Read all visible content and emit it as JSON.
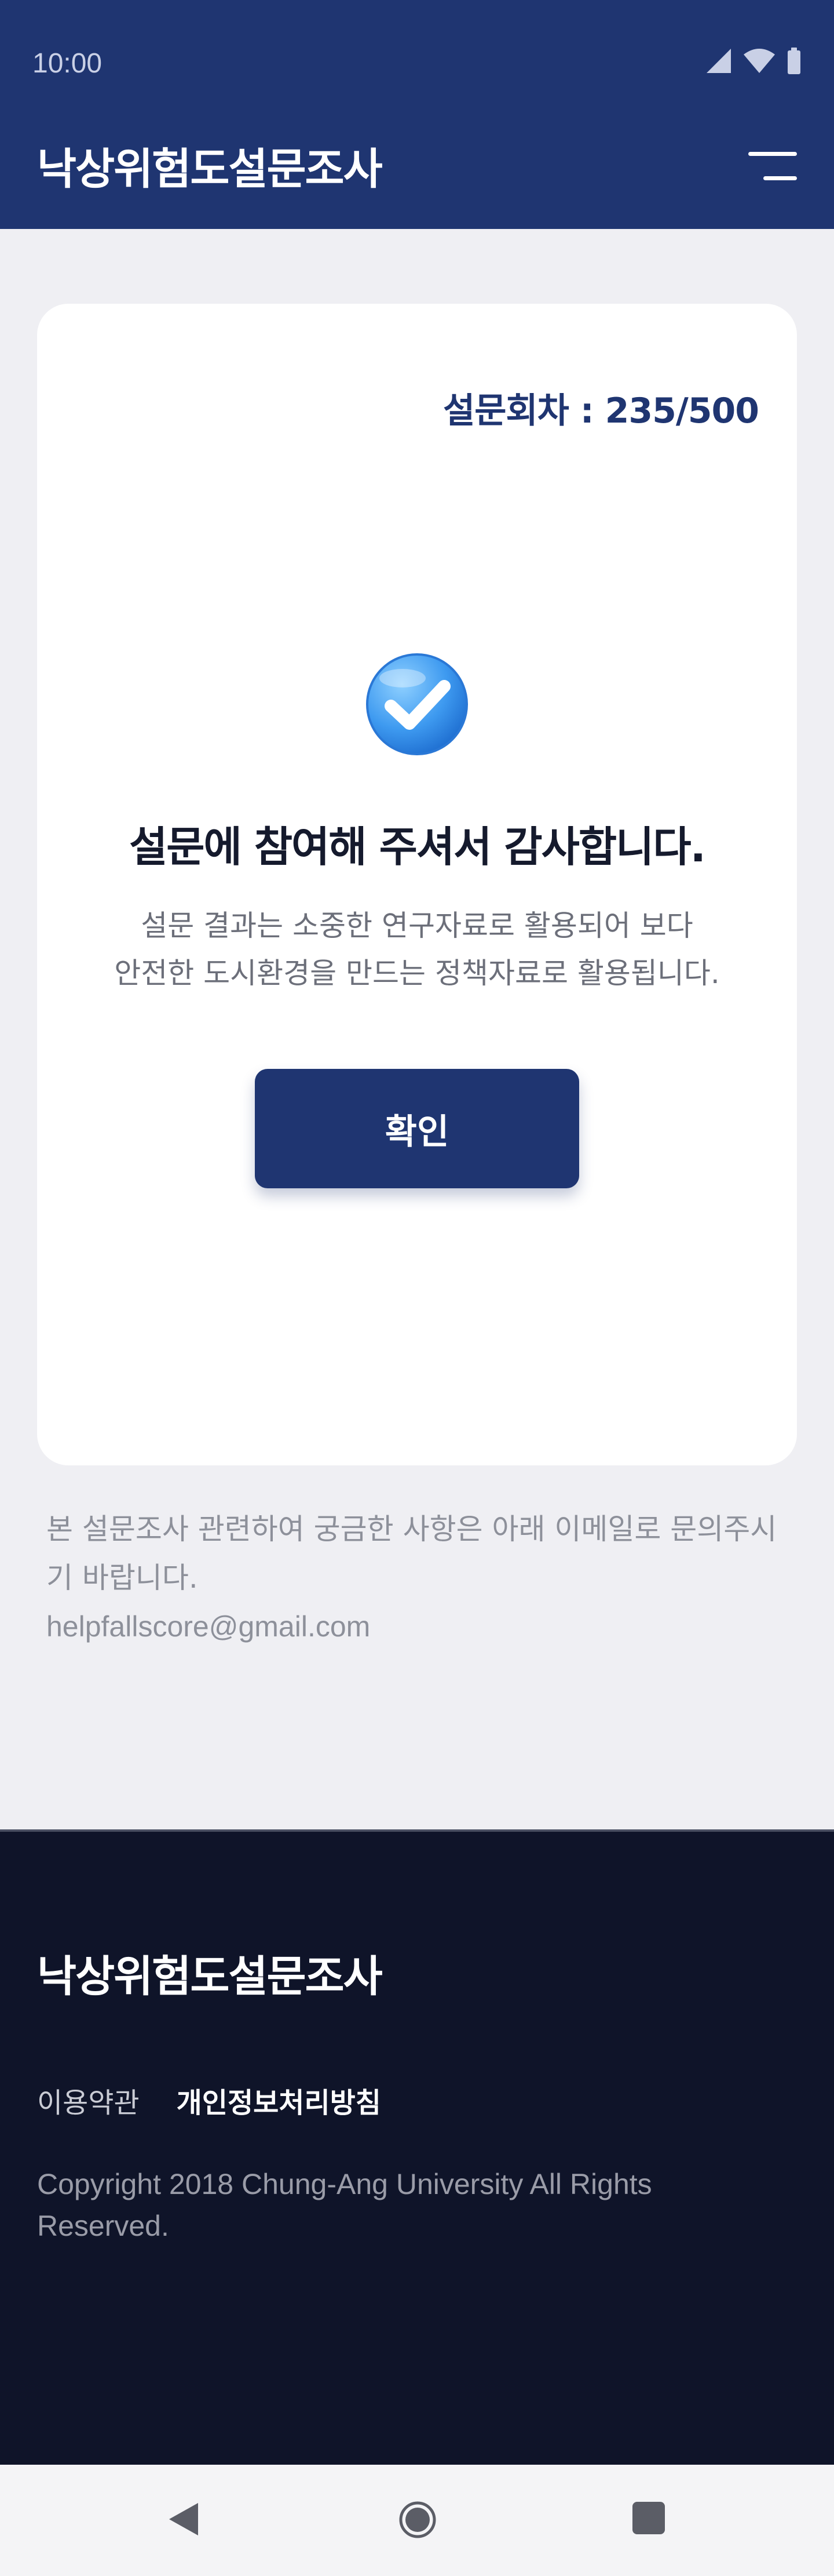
{
  "status_bar": {
    "time": "10:00",
    "icons": [
      "signal-icon",
      "wifi-icon",
      "battery-icon"
    ]
  },
  "header": {
    "title": "낙상위험도설문조사",
    "menu_icon": "menu-icon"
  },
  "card": {
    "round_label": "설문회차 : 235/500",
    "icon": "check-circle-icon",
    "thanks": "설문에 참여해 주셔서 감사합니다.",
    "desc_line1": "설문 결과는 소중한 연구자료로 활용되어 보다",
    "desc_line2": "안전한 도시환경을 만드는 정책자료로 활용됩니다.",
    "confirm_label": "확인"
  },
  "contact": {
    "line1": "본 설문조사 관련하여 궁금한 사항은 아래 이메일로 문의주시",
    "line2": "기 바랍니다.",
    "email": "helpfallscore@gmail.com"
  },
  "footer": {
    "title": "낙상위험도설문조사",
    "terms": "이용약관",
    "privacy": "개인정보처리방침",
    "copyright": "Copyright 2018 Chung-Ang University All Rights Reserved."
  },
  "nav": {
    "buttons": [
      "back-icon",
      "home-icon",
      "recents-icon"
    ]
  },
  "colors": {
    "primary": "#1f3571",
    "footer_bg": "#0f1429",
    "page_bg": "#efeff3",
    "check_blue": "#3e9af0"
  }
}
